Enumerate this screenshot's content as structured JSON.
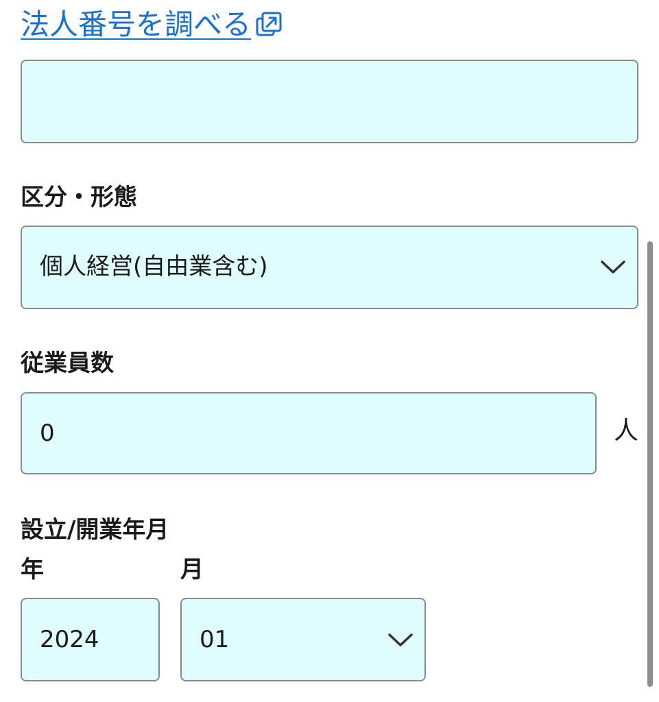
{
  "lookup_link": {
    "label": "法人番号を調べる",
    "icon": "external-link-icon"
  },
  "corp_number": {
    "value": ""
  },
  "business_type": {
    "label": "区分・形態",
    "selected": "個人経営(自由業含む)",
    "icon": "chevron-down-icon"
  },
  "employees": {
    "label": "従業員数",
    "value": "0",
    "unit": "人"
  },
  "founded": {
    "label": "設立/開業年月",
    "year_label": "年",
    "year_value": "2024",
    "month_label": "月",
    "month_selected": "01",
    "icon": "chevron-down-icon"
  },
  "colors": {
    "link": "#1a6fd1",
    "field_bg": "#e0fdfd",
    "field_border": "#8a8a8a"
  }
}
